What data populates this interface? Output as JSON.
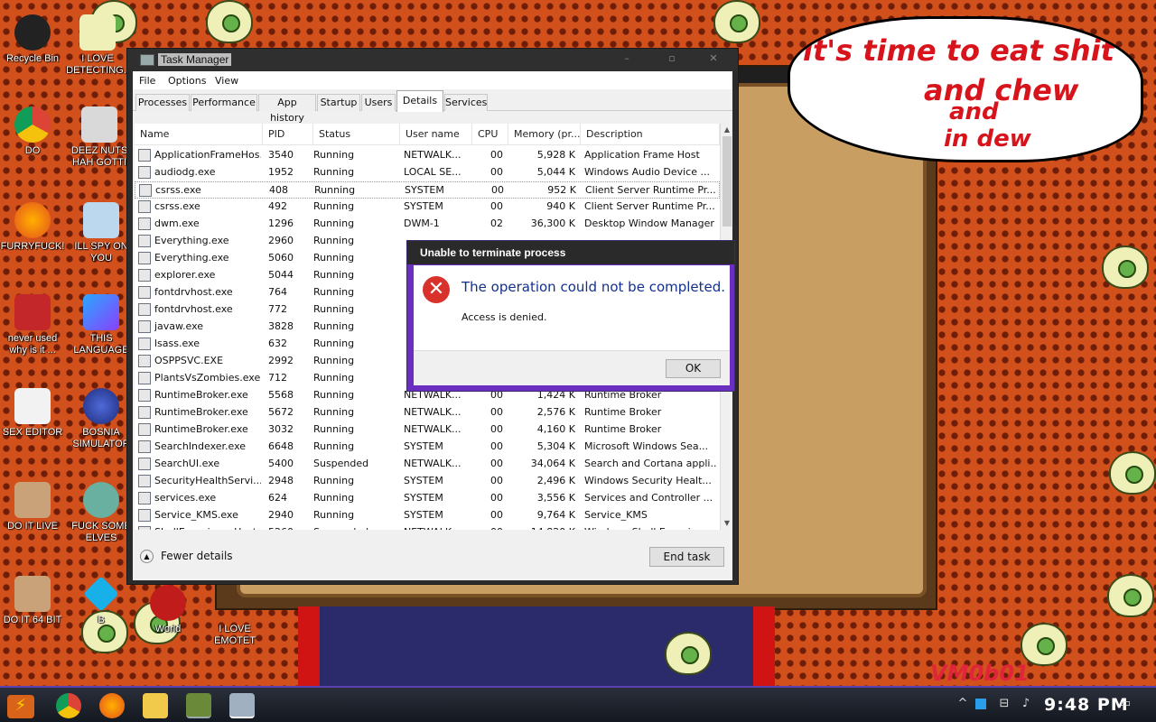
{
  "desktop": {
    "icons": [
      {
        "label": "Recycle Bin"
      },
      {
        "label": "I LOVE DETECTING.."
      },
      {
        "label": "DO"
      },
      {
        "label": "DEEZ NUTS HAH GOTTI"
      },
      {
        "label": "FURRYFUCK!"
      },
      {
        "label": "ILL SPY ON YOU"
      },
      {
        "label": "never used why is it ..."
      },
      {
        "label": "THIS LANGUAGE"
      },
      {
        "label": "SEX EDITOR"
      },
      {
        "label": "BOSNIA SIMULATOR"
      },
      {
        "label": "DO IT LIVE"
      },
      {
        "label": "FUCK SOME ELVES"
      },
      {
        "label": "DO IT 64 BIT"
      },
      {
        "label": "B"
      },
      {
        "label": "World"
      },
      {
        "label": "I LOVE EMOTET"
      }
    ],
    "speech_lines": [
      "it's time to eat shit",
      "and chew",
      "and",
      "in dew"
    ],
    "watermark": "VM0b01"
  },
  "task_manager": {
    "title": "Task Manager",
    "menu": [
      "File",
      "Options",
      "View"
    ],
    "tabs": [
      "Processes",
      "Performance",
      "App history",
      "Startup",
      "Users",
      "Details",
      "Services"
    ],
    "active_tab": "Details",
    "columns": [
      "Name",
      "PID",
      "Status",
      "User name",
      "CPU",
      "Memory (pr...",
      "Description"
    ],
    "rows": [
      [
        "ApplicationFrameHos...",
        "3540",
        "Running",
        "NETWALK...",
        "00",
        "5,928 K",
        "Application Frame Host"
      ],
      [
        "audiodg.exe",
        "1952",
        "Running",
        "LOCAL SE...",
        "00",
        "5,044 K",
        "Windows Audio Device ..."
      ],
      [
        "csrss.exe",
        "408",
        "Running",
        "SYSTEM",
        "00",
        "952 K",
        "Client Server Runtime Pr..."
      ],
      [
        "csrss.exe",
        "492",
        "Running",
        "SYSTEM",
        "00",
        "940 K",
        "Client Server Runtime Pr..."
      ],
      [
        "dwm.exe",
        "1296",
        "Running",
        "DWM-1",
        "02",
        "36,300 K",
        "Desktop Window Manager"
      ],
      [
        "Everything.exe",
        "2960",
        "Running",
        "",
        "",
        "",
        ""
      ],
      [
        "Everything.exe",
        "5060",
        "Running",
        "",
        "",
        "",
        ""
      ],
      [
        "explorer.exe",
        "5044",
        "Running",
        "",
        "",
        "",
        ""
      ],
      [
        "fontdrvhost.exe",
        "764",
        "Running",
        "",
        "",
        "",
        ""
      ],
      [
        "fontdrvhost.exe",
        "772",
        "Running",
        "",
        "",
        "",
        ""
      ],
      [
        "javaw.exe",
        "3828",
        "Running",
        "",
        "",
        "",
        ""
      ],
      [
        "lsass.exe",
        "632",
        "Running",
        "",
        "",
        "",
        ""
      ],
      [
        "OSPPSVC.EXE",
        "2992",
        "Running",
        "",
        "",
        "",
        ""
      ],
      [
        "PlantsVsZombies.exe",
        "712",
        "Running",
        "",
        "",
        "",
        ""
      ],
      [
        "RuntimeBroker.exe",
        "5568",
        "Running",
        "NETWALK...",
        "00",
        "1,424 K",
        "Runtime Broker"
      ],
      [
        "RuntimeBroker.exe",
        "5672",
        "Running",
        "NETWALK...",
        "00",
        "2,576 K",
        "Runtime Broker"
      ],
      [
        "RuntimeBroker.exe",
        "3032",
        "Running",
        "NETWALK...",
        "00",
        "4,160 K",
        "Runtime Broker"
      ],
      [
        "SearchIndexer.exe",
        "6648",
        "Running",
        "SYSTEM",
        "00",
        "5,304 K",
        "Microsoft Windows Sea..."
      ],
      [
        "SearchUI.exe",
        "5400",
        "Suspended",
        "NETWALK...",
        "00",
        "34,064 K",
        "Search and Cortana appli..."
      ],
      [
        "SecurityHealthServi...",
        "2948",
        "Running",
        "SYSTEM",
        "00",
        "2,496 K",
        "Windows Security Healt..."
      ],
      [
        "services.exe",
        "624",
        "Running",
        "SYSTEM",
        "00",
        "3,556 K",
        "Services and Controller ..."
      ],
      [
        "Service_KMS.exe",
        "2940",
        "Running",
        "SYSTEM",
        "00",
        "9,764 K",
        "Service_KMS"
      ],
      [
        "ShellExperienceHost...",
        "5260",
        "Suspended",
        "NETWALK...",
        "00",
        "14,820 K",
        "Windows Shell Experien..."
      ]
    ],
    "selected_row": 2,
    "fewer_details": "Fewer details",
    "end_task": "End task"
  },
  "dialog": {
    "title": "Unable to terminate process",
    "heading": "The operation could not be completed.",
    "message": "Access is denied.",
    "ok": "OK"
  },
  "taskbar": {
    "time": "9:48 PM"
  }
}
